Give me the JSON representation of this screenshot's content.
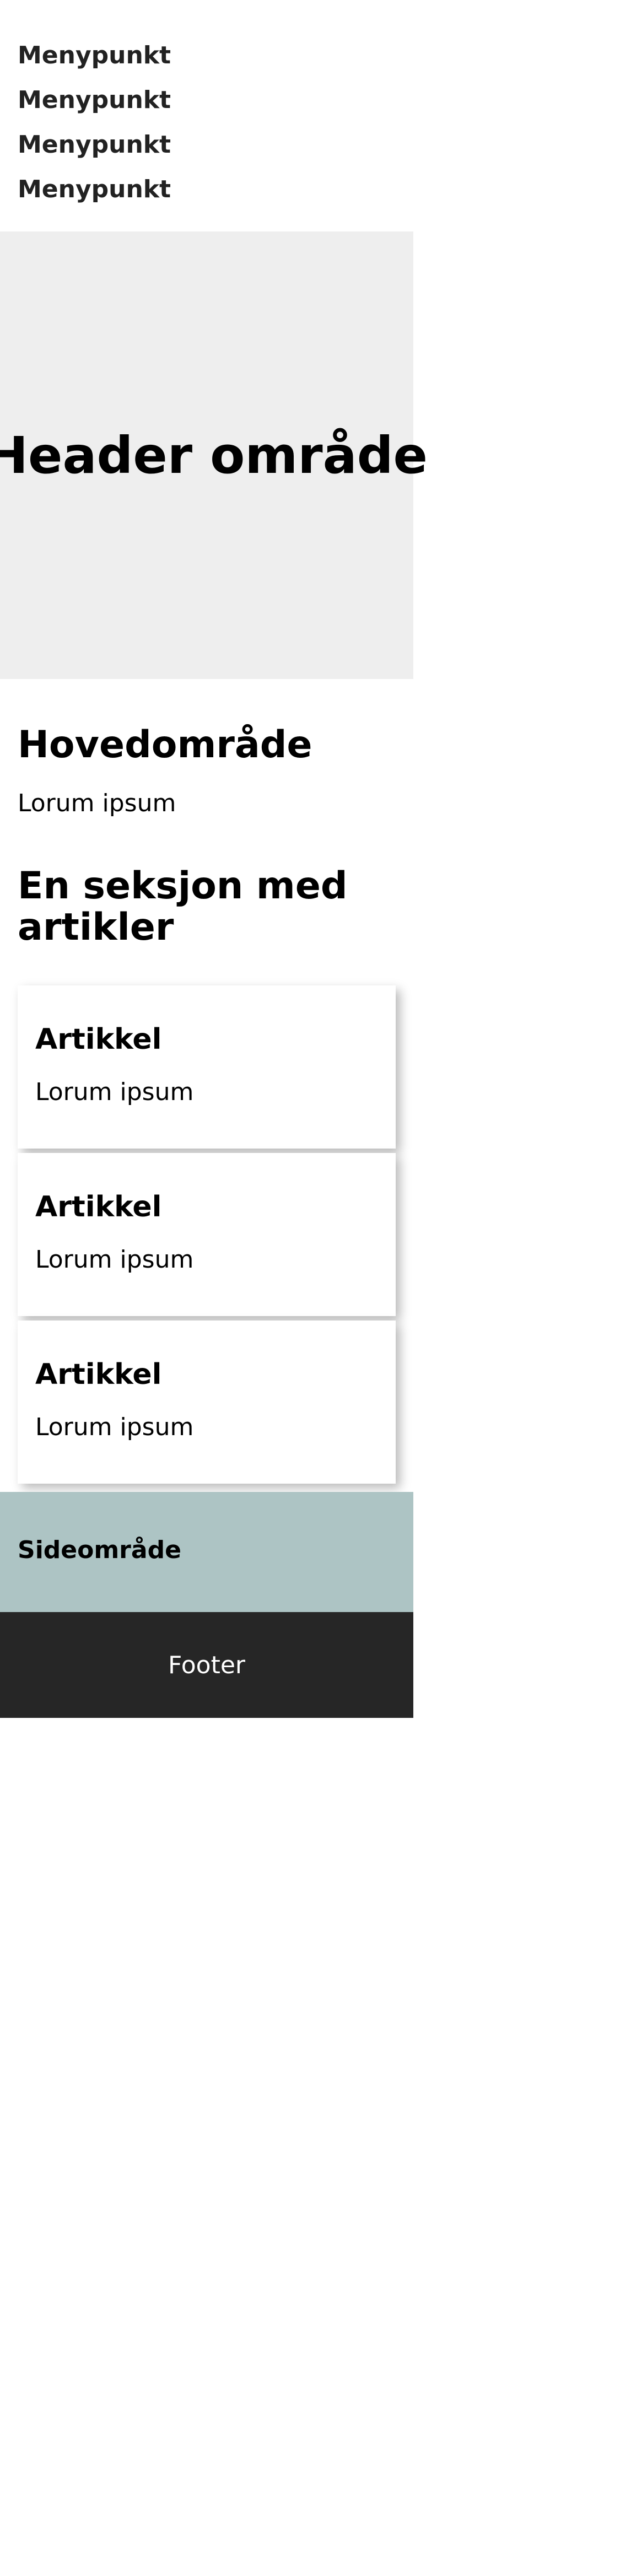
{
  "nav": {
    "items": [
      {
        "label": "Menypunkt"
      },
      {
        "label": "Menypunkt"
      },
      {
        "label": "Menypunkt"
      },
      {
        "label": "Menypunkt"
      }
    ]
  },
  "header": {
    "title": "Header område"
  },
  "main": {
    "title": "Hovedområde",
    "text": "Lorum ipsum",
    "section_title": "En seksjon med artikler",
    "articles": [
      {
        "title": "Artikkel",
        "text": "Lorum ipsum"
      },
      {
        "title": "Artikkel",
        "text": "Lorum ipsum"
      },
      {
        "title": "Artikkel",
        "text": "Lorum ipsum"
      }
    ]
  },
  "sidebar": {
    "title": "Sideområde"
  },
  "footer": {
    "text": "Footer"
  },
  "colors": {
    "header_bg": "#eeeeee",
    "sidebar_bg": "#adc4c4",
    "footer_bg": "#262626",
    "footer_text": "#ffffff",
    "nav_text": "#222222"
  }
}
